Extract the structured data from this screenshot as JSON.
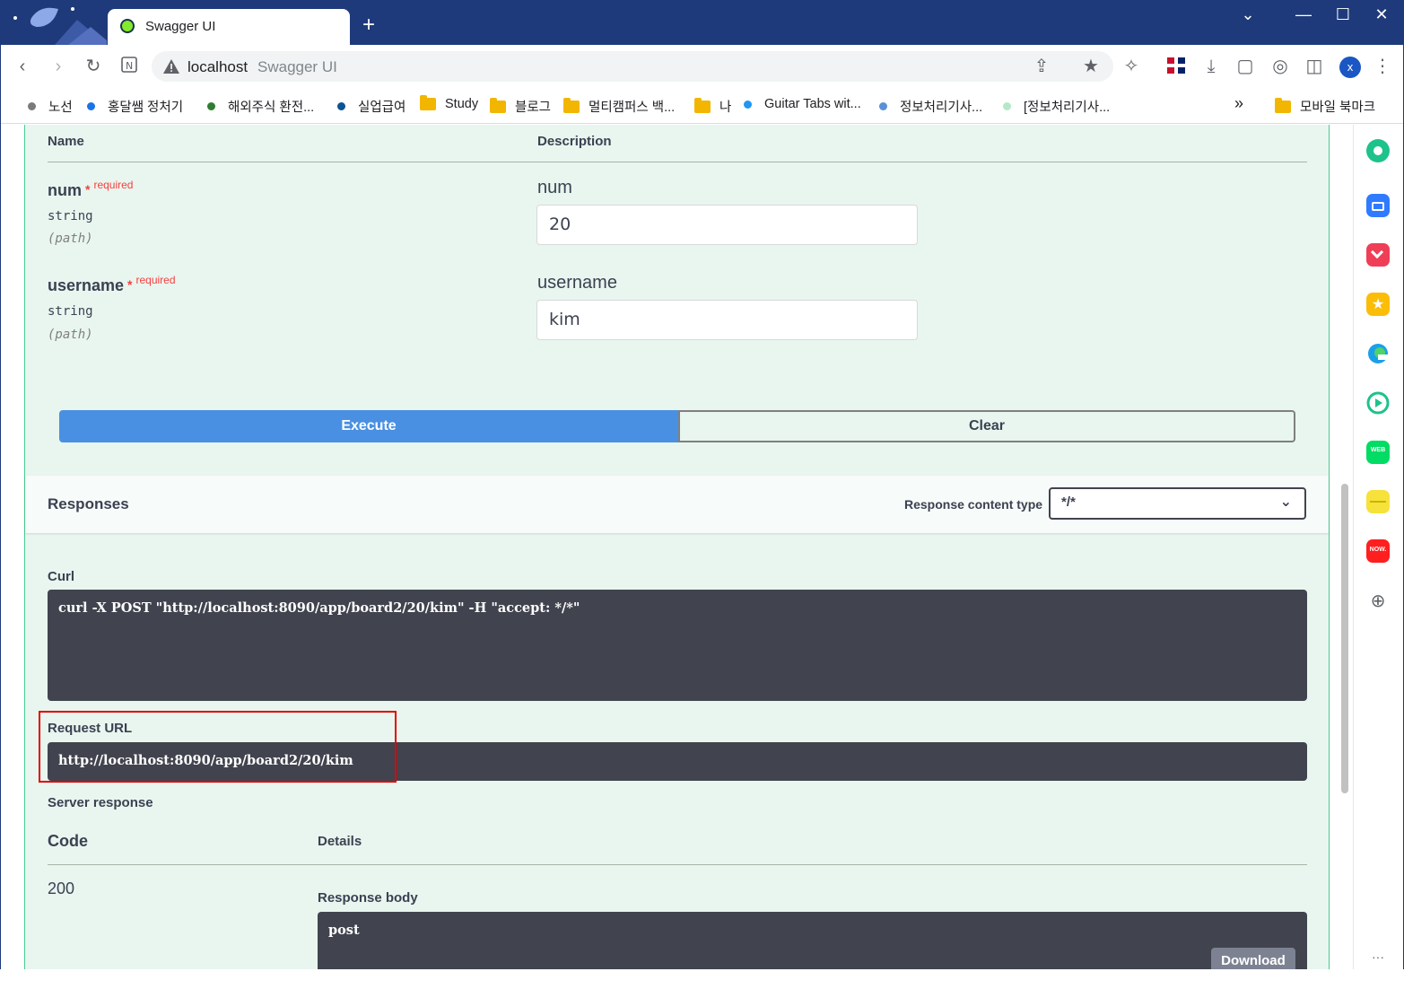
{
  "browser": {
    "tab_title": "Swagger UI",
    "new_tab_label": "+",
    "address_host": "localhost",
    "address_title": "Swagger UI",
    "profile_initial": "x",
    "icons": [
      "back-icon",
      "forward-icon",
      "reload-icon",
      "notion-icon",
      "share-icon",
      "bookmark-star-icon",
      "extensions-icon",
      "flag-icon",
      "download-icon",
      "capture-icon",
      "lens-icon",
      "sidebar-icon",
      "menu-icon"
    ]
  },
  "bookmarks": [
    {
      "label": "노선",
      "kind": "dot",
      "color": "#7a7a7a"
    },
    {
      "label": "홍달쌤 정처기",
      "kind": "dot",
      "color": "#1a73e8"
    },
    {
      "label": "해외주식 환전...",
      "kind": "dot",
      "color": "#2e7d32"
    },
    {
      "label": "실업급여",
      "kind": "dot",
      "color": "#0b5394"
    },
    {
      "label": "Study",
      "kind": "folder"
    },
    {
      "label": "블로그",
      "kind": "folder"
    },
    {
      "label": "멀티캠퍼스 백...",
      "kind": "folder"
    },
    {
      "label": "나",
      "kind": "folder"
    },
    {
      "label": "Guitar Tabs wit...",
      "kind": "dot",
      "color": "#2196f3"
    },
    {
      "label": "정보처리기사...",
      "kind": "dot",
      "color": "#5b8fd6"
    },
    {
      "label": "[정보처리기사...",
      "kind": "dot",
      "color": "#b5e8c8"
    }
  ],
  "bookmarks_overflow": "»",
  "bookmarks_mobile": "모바일 북마크",
  "params": {
    "header_name": "Name",
    "header_desc": "Description",
    "items": [
      {
        "name": "num",
        "star": "*",
        "required": "required",
        "type": "string",
        "in": "(path)",
        "desc": "num",
        "value": "20"
      },
      {
        "name": "username",
        "star": "*",
        "required": "required",
        "type": "string",
        "in": "(path)",
        "desc": "username",
        "value": "kim"
      }
    ]
  },
  "actions": {
    "execute": "Execute",
    "clear": "Clear"
  },
  "responses": {
    "title": "Responses",
    "content_type_label": "Response content type",
    "content_type_value": "*/*",
    "curl_label": "Curl",
    "curl": "curl -X POST \"http://localhost:8090/app/board2/20/kim\" -H \"accept: */*\"",
    "request_url_label": "Request URL",
    "request_url": "http://localhost:8090/app/board2/20/kim",
    "server_response_label": "Server response",
    "code_header": "Code",
    "details_header": "Details",
    "code": "200",
    "response_body_label": "Response body",
    "response_body": "post",
    "download_label": "Download"
  },
  "side_panel_icons": [
    "green-circle-icon",
    "briefcase-icon",
    "pocket-icon",
    "star-icon",
    "edge-icon",
    "play-icon",
    "webtoon-icon",
    "notes-icon",
    "now-icon",
    "add-icon",
    "more-icon"
  ]
}
